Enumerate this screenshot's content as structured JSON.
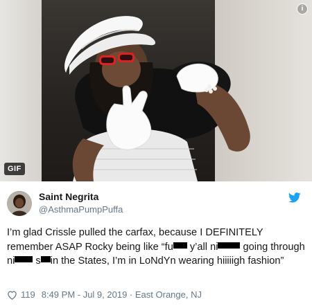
{
  "media": {
    "badge": "GIF",
    "info_icon": "info-icon",
    "image_name": "gif-still"
  },
  "tweet": {
    "author_name": "Saint Negrita",
    "handle": "@AsthmaPumpPuffa",
    "text": {
      "p1": "I’m glad Crissle pulled the carfax, because I DEFINITELY remember ASAP Rocky being like “fu",
      "p2": " y’all ni",
      "p3": " going through ni",
      "p4": " s",
      "p5": "in the States, I’m in LoNdYn wearing hiiiiigh fashion”"
    },
    "likes": "119",
    "timestamp": "8:49 PM - Jul 9, 2019",
    "location": "East Orange, NJ",
    "separator": " · ",
    "brand_color": "#1da1f2",
    "icons": [
      "twitter-bird-icon",
      "heart-icon",
      "avatar"
    ]
  }
}
